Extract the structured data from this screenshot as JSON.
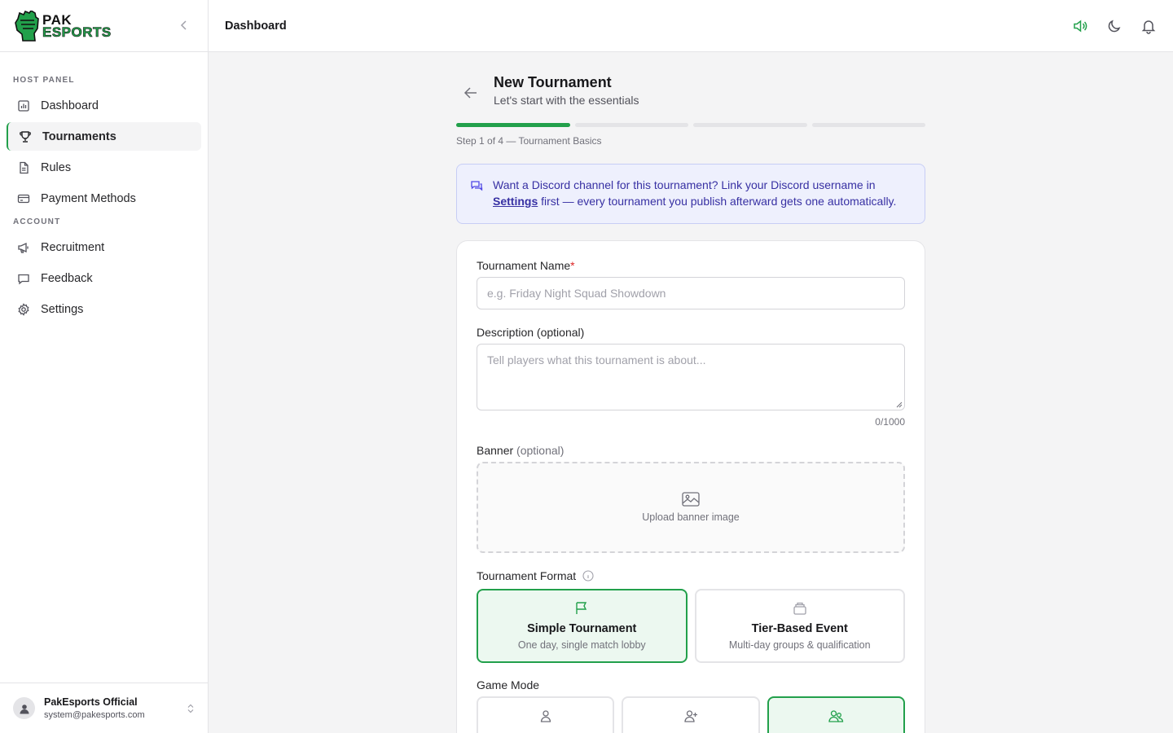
{
  "app": {
    "logo_line1": "PAK",
    "logo_line2": "ESPORTS"
  },
  "sidebar": {
    "sections": [
      {
        "title": "HOST PANEL",
        "items": [
          {
            "label": "Dashboard",
            "icon": "bar-chart-icon"
          },
          {
            "label": "Tournaments",
            "icon": "trophy-icon",
            "active": true
          },
          {
            "label": "Rules",
            "icon": "document-icon"
          },
          {
            "label": "Payment Methods",
            "icon": "credit-card-icon"
          }
        ]
      },
      {
        "title": "ACCOUNT",
        "items": [
          {
            "label": "Recruitment",
            "icon": "megaphone-icon"
          },
          {
            "label": "Feedback",
            "icon": "chat-icon"
          },
          {
            "label": "Settings",
            "icon": "gear-icon"
          }
        ]
      }
    ],
    "user": {
      "name": "PakEsports Official",
      "email": "system@pakesports.com"
    }
  },
  "topbar": {
    "breadcrumb": "Dashboard",
    "accent_color": "#22a04b"
  },
  "page": {
    "title": "New Tournament",
    "subtitle": "Let's start with the essentials",
    "progress": {
      "current_step": 1,
      "total_steps": 4
    },
    "step_text": "Step 1 of 4 — Tournament Basics"
  },
  "notice": {
    "text_before": "Want a Discord channel for this tournament? Link your Discord username in ",
    "link_text": "Settings",
    "text_after": " first — every tournament you publish afterward gets one automatically."
  },
  "form": {
    "name": {
      "label": "Tournament Name",
      "required_mark": "*",
      "placeholder": "e.g. Friday Night Squad Showdown",
      "value": ""
    },
    "description": {
      "label": "Description (optional)",
      "placeholder": "Tell players what this tournament is about...",
      "counter": "0/1000"
    },
    "banner": {
      "label": "Banner",
      "optional": "(optional)",
      "upload_text": "Upload banner image"
    },
    "format": {
      "label": "Tournament Format",
      "options": [
        {
          "title": "Simple Tournament",
          "desc": "One day, single match lobby",
          "selected": true
        },
        {
          "title": "Tier-Based Event",
          "desc": "Multi-day groups & qualification",
          "selected": false
        }
      ]
    },
    "game_mode": {
      "label": "Game Mode",
      "options": [
        {
          "icon": "user-icon",
          "selected": false
        },
        {
          "icon": "user-plus-icon",
          "selected": false
        },
        {
          "icon": "users-icon",
          "selected": true
        }
      ]
    }
  }
}
